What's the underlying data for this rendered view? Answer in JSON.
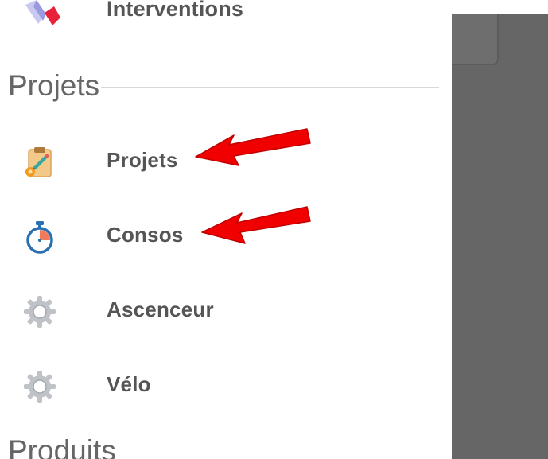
{
  "drawer": {
    "cut_item": {
      "label": "Interventions",
      "icon": "interventions-icon"
    },
    "section": {
      "title": "Projets"
    },
    "items": [
      {
        "label": "Projets",
        "icon": "clipboard-icon"
      },
      {
        "label": "Consos",
        "icon": "stopwatch-icon"
      },
      {
        "label": "Ascenceur",
        "icon": "gear-icon"
      },
      {
        "label": "Vélo",
        "icon": "gear-icon"
      }
    ],
    "next_section": {
      "title": "Produits"
    }
  },
  "colors": {
    "label": "#555555",
    "overlay": "#666666",
    "arrow": "#ff0000",
    "divider": "#d8d8d8"
  }
}
